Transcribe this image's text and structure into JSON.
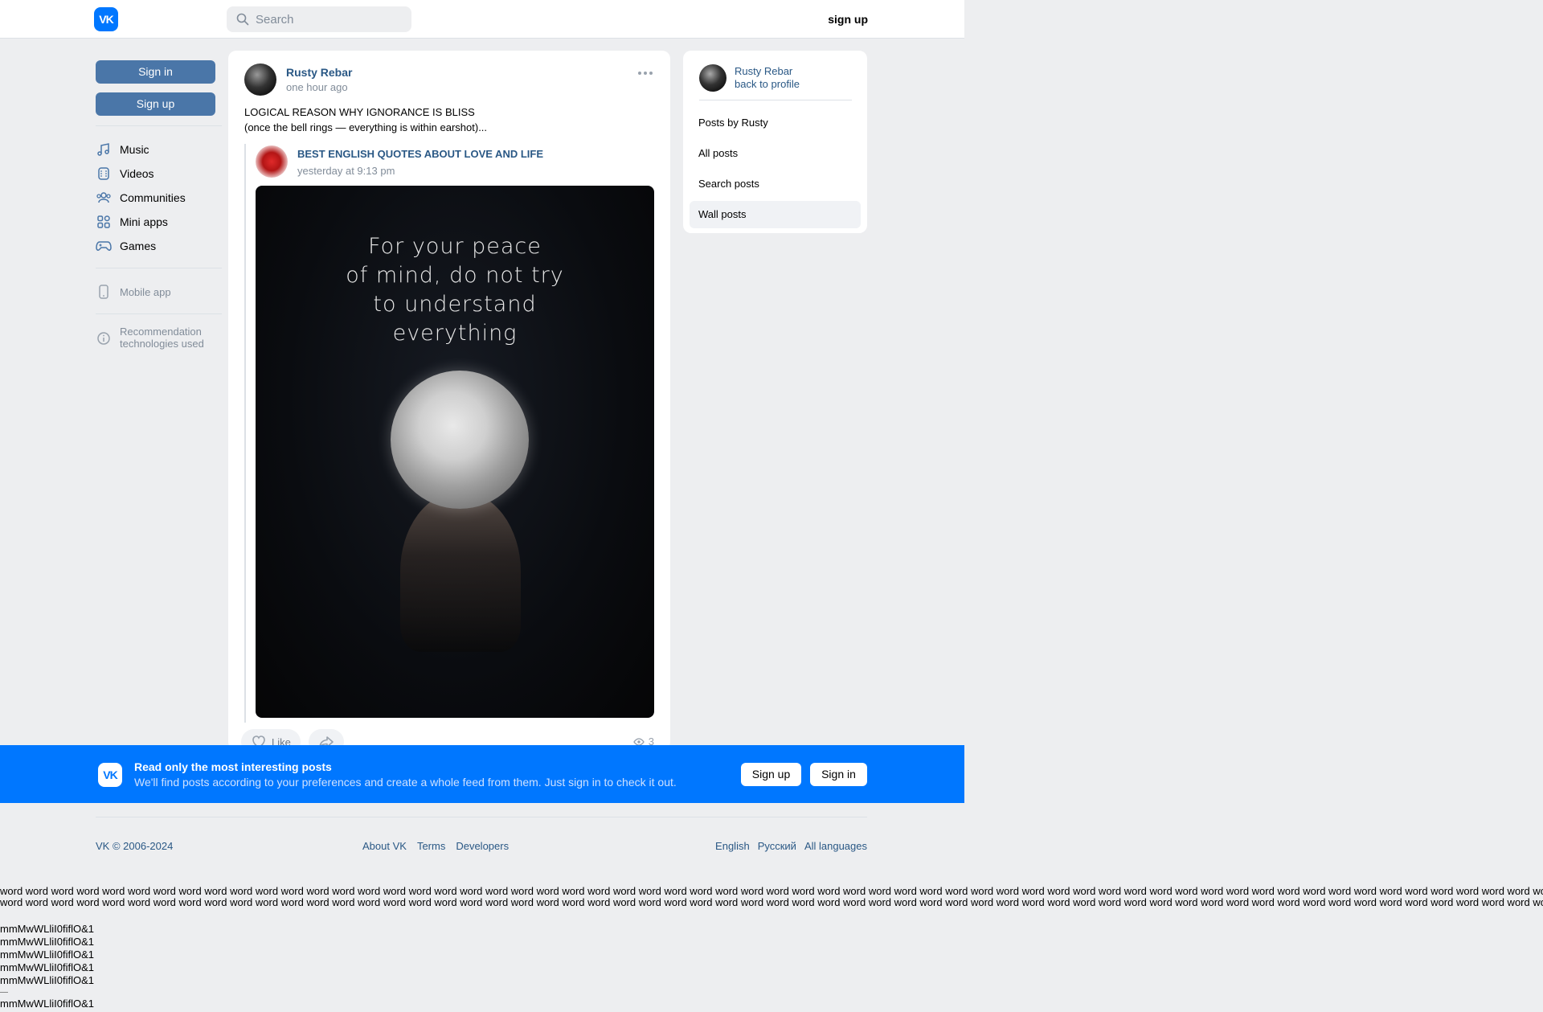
{
  "header": {
    "logo_text": "VK",
    "search_placeholder": "Search",
    "signup_label": "sign up"
  },
  "left": {
    "signin_label": "Sign in",
    "signup_label": "Sign up",
    "nav": [
      {
        "label": "Music",
        "icon": "music-icon"
      },
      {
        "label": "Videos",
        "icon": "video-icon"
      },
      {
        "label": "Communities",
        "icon": "communities-icon"
      },
      {
        "label": "Mini apps",
        "icon": "mini-apps-icon"
      },
      {
        "label": "Games",
        "icon": "gamepad-icon"
      }
    ],
    "mobile_app": "Mobile app",
    "recommendation_line1": "Recommendation",
    "recommendation_line2": "technologies used"
  },
  "post": {
    "author": "Rusty Rebar",
    "time": "one hour ago",
    "text_line1": "LOGICAL REASON WHY IGNORANCE IS BLISS",
    "text_line2": "(once the bell rings — everything is within earshot)...",
    "repost": {
      "title": "BEST ENGLISH QUOTES ABOUT LOVE AND LIFE",
      "time": "yesterday at 9:13 pm",
      "photo_quote_lines": [
        "For your peace",
        "of mind, do not try",
        "to understand",
        "everything"
      ]
    },
    "like_label": "Like",
    "views": "3"
  },
  "right": {
    "name": "Rusty Rebar",
    "back": "back to profile",
    "items": [
      "Posts by Rusty",
      "All posts",
      "Search posts",
      "Wall posts"
    ]
  },
  "banner": {
    "logo_text": "VK",
    "title": "Read only the most interesting posts",
    "subtitle": "We'll find posts according to your preferences and create a whole feed from them. Just sign in to check it out.",
    "signup_label": "Sign up",
    "signin_label": "Sign in"
  },
  "footer": {
    "copyright": "VK © 2006-2024",
    "links": [
      "About VK",
      "Terms",
      "Developers"
    ],
    "languages": [
      "English",
      "Русский",
      "All languages"
    ]
  },
  "filler": {
    "line": "word word word word word word word word word word word word word word word word word word word word word word word word word word word word word word word word word word word word word word word word word word word word word word word word word word word word word word word word word word word word word word word word",
    "code": "mmMwWLliI0fiflO&1"
  },
  "colors": {
    "brand": "#0077ff",
    "button": "#4a76a8",
    "link": "#2a5885"
  }
}
